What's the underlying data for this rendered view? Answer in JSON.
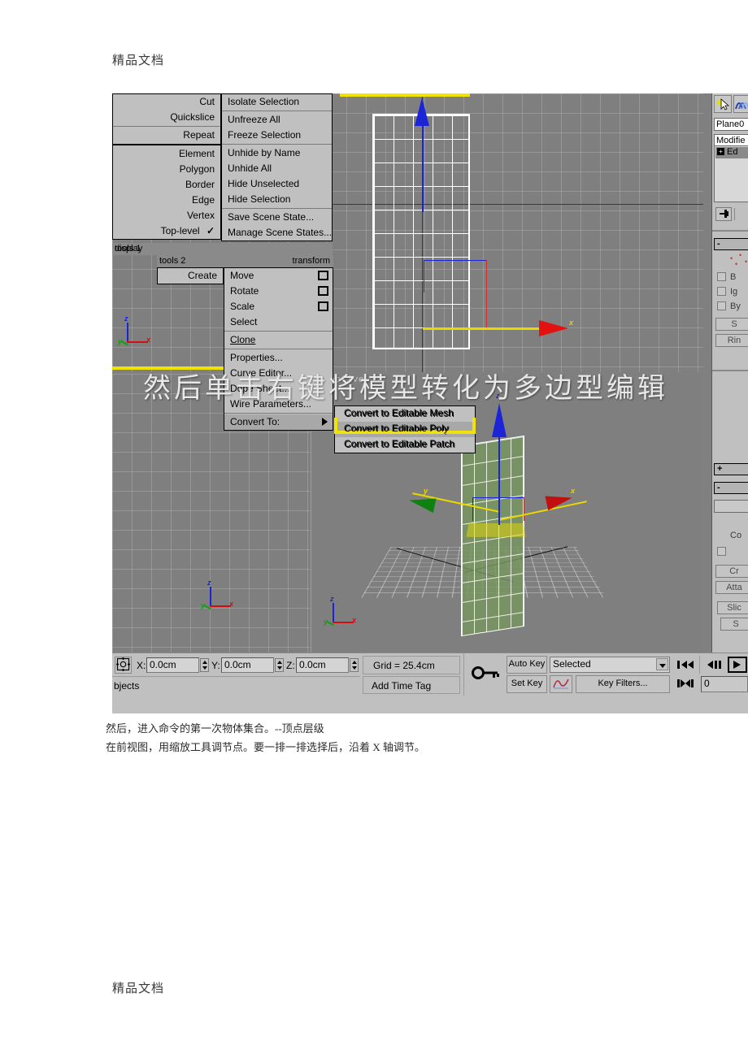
{
  "document": {
    "header_text": "精品文档",
    "footer_text": "精品文档",
    "caption_line1": "然后，进入命令的第一次物体集合。--顶点层级",
    "caption_line2": "在前视图，用缩放工具调节点。要一排一排选择后，沿着 X 轴调节。"
  },
  "overlay": {
    "text": "然后单击右键将模型转化为多边型编辑"
  },
  "quad_menu": {
    "tools1": {
      "header": "tools 1",
      "items": [
        "Cut",
        "Quickslice",
        "Repeat",
        "Element",
        "Polygon",
        "Border",
        "Edge",
        "Vertex",
        "Top-level"
      ],
      "checked_item": "Top-level",
      "check_glyph": "✓"
    },
    "display": {
      "header": "display",
      "items": [
        "Isolate Selection",
        "Unfreeze All",
        "Freeze Selection",
        "Unhide by Name",
        "Unhide All",
        "Hide Unselected",
        "Hide Selection",
        "Save Scene State...",
        "Manage Scene States..."
      ]
    },
    "tools2": {
      "header": "tools 2",
      "items": [
        "Create"
      ]
    },
    "transform": {
      "header": "transform",
      "items": [
        {
          "label": "Move",
          "icon": "settings-box-icon"
        },
        {
          "label": "Rotate",
          "icon": "settings-box-icon"
        },
        {
          "label": "Scale",
          "icon": "settings-box-icon"
        },
        {
          "label": "Select",
          "icon": ""
        },
        {
          "label": "Clone",
          "icon": ""
        },
        {
          "label": "Properties...",
          "icon": ""
        },
        {
          "label": "Curve Editor...",
          "icon": ""
        },
        {
          "label": "Dope Sheet...",
          "icon": ""
        },
        {
          "label": "Wire Parameters...",
          "icon": ""
        },
        {
          "label": "Convert To:",
          "icon": "submenu-arrow-icon"
        }
      ]
    },
    "convert_submenu": {
      "items": [
        "Convert to Editable Mesh",
        "Convert to Editable Poly",
        "Convert to Editable Patch"
      ],
      "highlighted": "Convert to Editable Poly"
    }
  },
  "viewports": {
    "front_label": "",
    "persp_label": "spective",
    "axis_x": "x",
    "axis_y": "y",
    "axis_z": "z"
  },
  "command_panel": {
    "object_name": "Plane0",
    "modifier_dropdown": "Modifie",
    "stack_item": "Ed",
    "stack_plus": "+",
    "pin_icon": "pin-stack-icon",
    "rollup_collapsed": "+",
    "rollup_expanded": "-",
    "checkboxes": [
      "B",
      "Ig",
      "By"
    ],
    "buttons": [
      "S",
      "Rin",
      "Co",
      "Cr",
      "Atta",
      "Slic",
      "S"
    ]
  },
  "status_bar": {
    "lock_icon": "selection-lock-icon",
    "x_label": "X:",
    "x_value": "0.0cm",
    "y_label": "Y:",
    "y_value": "0.0cm",
    "z_label": "Z:",
    "z_value": "0.0cm",
    "grid_text": "Grid = 25.4cm",
    "objects_text": "bjects",
    "add_time_tag": "Add Time Tag",
    "key_icon": "key-icon",
    "auto_key": "Auto Key",
    "set_key": "Set Key",
    "selection_level": "Selected",
    "key_filters": "Key Filters...",
    "curve_icon": "animation-curve-icon",
    "frame_value": "0",
    "playback": {
      "go_to_start": "start-icon",
      "prev_frame": "prev-frame-icon",
      "play": "play-icon",
      "next_frame": "next-frame-icon",
      "go_to_end": "end-icon"
    }
  },
  "colors": {
    "panel_gray": "#c0c0c0",
    "viewport_gray": "#7f7f7f",
    "menu_header": "#8a8a8a",
    "highlight": "#a8a8a8",
    "yellow": "#f2e400",
    "axis_x_red": "#d01010",
    "axis_y_green": "#11a011",
    "axis_z_blue": "#1c24d8",
    "plane_green": "#788d5f"
  }
}
